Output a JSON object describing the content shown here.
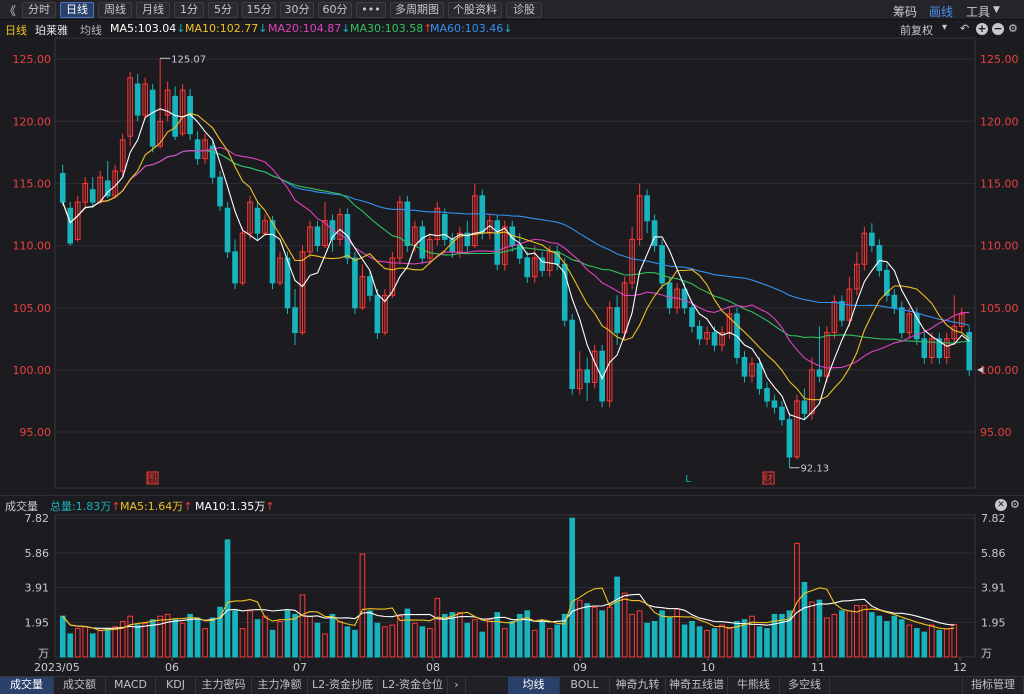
{
  "toolbar": {
    "back": "《",
    "periods": [
      "分时",
      "日线",
      "周线",
      "月线",
      "1分",
      "5分",
      "15分",
      "30分",
      "60分",
      "•••",
      "多周期图",
      "个股资料",
      "诊股"
    ],
    "active_period": "日线",
    "right": [
      "筹码",
      "画线",
      "工具"
    ],
    "tools_arrow": "▼"
  },
  "info": {
    "period": "日线",
    "stock": "珀莱雅",
    "line_type": "均线",
    "ma5": "MA5:103.04",
    "ma10": "MA10:102.77",
    "ma20": "MA20:104.87",
    "ma30": "MA30:103.58",
    "ma60": "MA60:103.46",
    "ma5_dir": "↓",
    "ma10_dir": "↓",
    "ma20_dir": "↓",
    "ma30_dir": "↑",
    "ma60_dir": "↓",
    "restore": "前复权",
    "colors": {
      "ma5": "#ffffff",
      "ma10": "#f0c020",
      "ma20": "#e040c0",
      "ma30": "#30c060",
      "ma60": "#3090f0",
      "up": "#ff3838",
      "down": "#18b4be"
    }
  },
  "price_axis": [
    "125.00",
    "120.00",
    "115.00",
    "110.00",
    "105.00",
    "100.00",
    "95.00"
  ],
  "annotations": {
    "high": "125.07",
    "low": "92.13",
    "markers": [
      "图",
      "L",
      "财"
    ]
  },
  "volume": {
    "title": "成交量",
    "total": "总量:1.83万",
    "total_dir": "↑",
    "ma5": "MA5:1.64万",
    "ma5_dir": "↑",
    "ma10": "MA10:1.35万",
    "ma10_dir": "↑",
    "axis": [
      "7.82",
      "5.86",
      "3.91",
      "1.95",
      "万"
    ]
  },
  "x_labels": [
    "2023/05",
    "06",
    "07",
    "08",
    "09",
    "10",
    "11",
    "12"
  ],
  "bottom_tabs_left": [
    "成交量",
    "成交额",
    "MACD",
    "KDJ",
    "主力密码",
    "主力净额",
    "L2-资金抄底",
    "L2-资金仓位"
  ],
  "bottom_tabs_right": [
    "均线",
    "BOLL",
    "神奇九转",
    "神奇五线谱",
    "牛熊线",
    "多空线"
  ],
  "bottom_right": "指标管理",
  "chart_data": {
    "type": "candlestick",
    "ohlc": [
      [
        115.8,
        113.5,
        116.5,
        113.2
      ],
      [
        113.0,
        110.2,
        113.5,
        110.0
      ],
      [
        110.5,
        113.5,
        114.0,
        110.3
      ],
      [
        113.5,
        115.0,
        115.5,
        113.0
      ],
      [
        114.5,
        113.5,
        115.5,
        113.0
      ],
      [
        113.5,
        115.5,
        116.0,
        113.3
      ],
      [
        115.2,
        114.0,
        116.8,
        113.8
      ],
      [
        114.0,
        116.0,
        116.5,
        113.8
      ],
      [
        116.0,
        118.5,
        119.0,
        115.5
      ],
      [
        118.8,
        123.5,
        124.0,
        118.0
      ],
      [
        123.0,
        120.5,
        123.8,
        120.0
      ],
      [
        120.5,
        123.0,
        123.5,
        120.2
      ],
      [
        122.5,
        118.0,
        123.0,
        117.5
      ],
      [
        118.0,
        120.0,
        125.07,
        117.8
      ],
      [
        120.5,
        122.5,
        123.2,
        120.0
      ],
      [
        122.0,
        118.8,
        122.8,
        118.5
      ],
      [
        119.0,
        122.5,
        123.0,
        118.8
      ],
      [
        122.0,
        119.0,
        122.6,
        118.5
      ],
      [
        118.5,
        117.0,
        119.2,
        116.5
      ],
      [
        117.0,
        118.5,
        119.0,
        116.6
      ],
      [
        118.0,
        115.5,
        118.5,
        115.0
      ],
      [
        115.5,
        113.2,
        116.0,
        112.8
      ],
      [
        113.0,
        109.5,
        113.5,
        109.0
      ],
      [
        109.5,
        107.0,
        110.5,
        106.5
      ],
      [
        107.0,
        111.0,
        111.5,
        106.8
      ],
      [
        111.0,
        113.5,
        114.0,
        110.5
      ],
      [
        113.0,
        111.0,
        113.5,
        110.5
      ],
      [
        111.0,
        112.0,
        112.5,
        110.8
      ],
      [
        112.0,
        107.0,
        112.4,
        106.5
      ],
      [
        107.0,
        109.0,
        109.5,
        106.8
      ],
      [
        109.0,
        105.0,
        109.5,
        104.5
      ],
      [
        105.0,
        103.0,
        106.5,
        102.0
      ],
      [
        103.0,
        109.5,
        110.0,
        102.8
      ],
      [
        109.5,
        111.5,
        112.0,
        109.0
      ],
      [
        111.5,
        110.0,
        112.0,
        109.5
      ],
      [
        110.0,
        112.0,
        113.5,
        109.8
      ],
      [
        112.0,
        110.5,
        112.5,
        109.5
      ],
      [
        110.5,
        112.5,
        113.0,
        110.0
      ],
      [
        112.5,
        109.0,
        113.0,
        108.5
      ],
      [
        109.0,
        105.0,
        109.5,
        104.5
      ],
      [
        105.0,
        107.5,
        108.5,
        104.8
      ],
      [
        107.5,
        106.0,
        108.0,
        105.5
      ],
      [
        106.0,
        103.0,
        106.5,
        102.5
      ],
      [
        103.0,
        106.0,
        106.5,
        102.8
      ],
      [
        106.0,
        109.0,
        109.5,
        105.8
      ],
      [
        109.0,
        113.5,
        114.0,
        108.5
      ],
      [
        113.5,
        110.0,
        114.0,
        109.5
      ],
      [
        110.0,
        111.5,
        112.0,
        109.5
      ],
      [
        111.5,
        109.0,
        112.0,
        108.5
      ],
      [
        109.0,
        110.5,
        111.0,
        108.5
      ],
      [
        110.5,
        113.0,
        113.5,
        110.0
      ],
      [
        112.5,
        110.5,
        113.0,
        110.0
      ],
      [
        110.5,
        109.5,
        111.0,
        109.0
      ],
      [
        109.5,
        111.0,
        111.5,
        109.0
      ],
      [
        111.0,
        110.0,
        112.0,
        109.5
      ],
      [
        110.0,
        114.0,
        115.0,
        109.8
      ],
      [
        114.0,
        111.0,
        114.5,
        110.5
      ],
      [
        111.0,
        112.0,
        112.5,
        110.5
      ],
      [
        112.0,
        108.5,
        112.5,
        108.0
      ],
      [
        108.5,
        111.5,
        112.0,
        108.0
      ],
      [
        111.5,
        110.0,
        112.0,
        109.5
      ],
      [
        110.0,
        109.0,
        111.0,
        108.5
      ],
      [
        109.0,
        107.5,
        109.5,
        107.0
      ],
      [
        107.5,
        109.0,
        110.0,
        107.0
      ],
      [
        109.0,
        108.0,
        109.5,
        107.5
      ],
      [
        108.0,
        109.5,
        110.0,
        107.5
      ],
      [
        109.5,
        108.5,
        110.0,
        108.0
      ],
      [
        108.5,
        104.0,
        109.0,
        103.5
      ],
      [
        104.0,
        98.5,
        104.5,
        98.0
      ],
      [
        98.5,
        100.0,
        101.5,
        98.0
      ],
      [
        100.0,
        99.0,
        101.0,
        97.5
      ],
      [
        99.0,
        101.5,
        102.0,
        98.5
      ],
      [
        101.5,
        97.5,
        102.0,
        97.0
      ],
      [
        97.5,
        105.0,
        105.5,
        97.0
      ],
      [
        105.0,
        103.0,
        106.0,
        102.0
      ],
      [
        103.0,
        107.0,
        107.5,
        102.5
      ],
      [
        107.0,
        110.5,
        111.5,
        106.5
      ],
      [
        110.5,
        114.0,
        115.0,
        110.0
      ],
      [
        114.0,
        112.0,
        114.5,
        111.0
      ],
      [
        112.0,
        110.0,
        112.5,
        109.5
      ],
      [
        110.0,
        107.0,
        110.5,
        106.5
      ],
      [
        107.0,
        105.0,
        107.5,
        104.5
      ],
      [
        105.0,
        106.5,
        107.0,
        104.5
      ],
      [
        106.5,
        105.0,
        107.0,
        104.5
      ],
      [
        105.0,
        103.5,
        105.5,
        103.0
      ],
      [
        103.5,
        102.5,
        104.0,
        102.0
      ],
      [
        102.5,
        103.0,
        103.5,
        102.0
      ],
      [
        103.0,
        102.0,
        103.5,
        101.5
      ],
      [
        102.0,
        103.0,
        103.5,
        101.5
      ],
      [
        103.0,
        104.5,
        105.0,
        102.5
      ],
      [
        104.5,
        101.0,
        105.0,
        100.5
      ],
      [
        101.0,
        99.5,
        101.5,
        99.0
      ],
      [
        99.5,
        100.5,
        101.0,
        99.0
      ],
      [
        100.5,
        98.5,
        101.0,
        98.0
      ],
      [
        98.5,
        97.5,
        99.0,
        97.0
      ],
      [
        97.5,
        97.0,
        98.0,
        96.5
      ],
      [
        97.0,
        96.0,
        97.5,
        95.5
      ],
      [
        96.0,
        93.0,
        96.5,
        92.13
      ],
      [
        93.0,
        97.5,
        98.0,
        92.8
      ],
      [
        97.5,
        96.5,
        98.5,
        96.0
      ],
      [
        96.5,
        100.0,
        101.0,
        96.0
      ],
      [
        100.0,
        99.5,
        103.5,
        99.0
      ],
      [
        99.5,
        103.0,
        103.5,
        99.0
      ],
      [
        103.0,
        105.5,
        106.0,
        102.5
      ],
      [
        105.5,
        104.0,
        106.0,
        103.5
      ],
      [
        104.0,
        106.5,
        107.5,
        103.5
      ],
      [
        106.5,
        108.5,
        109.5,
        106.0
      ],
      [
        108.5,
        111.0,
        111.5,
        108.0
      ],
      [
        111.0,
        110.0,
        111.8,
        109.5
      ],
      [
        110.0,
        108.0,
        110.5,
        107.5
      ],
      [
        108.0,
        106.0,
        108.5,
        105.5
      ],
      [
        106.0,
        105.0,
        106.5,
        104.5
      ],
      [
        105.0,
        103.0,
        105.5,
        102.5
      ],
      [
        103.0,
        104.5,
        105.0,
        102.5
      ],
      [
        104.5,
        102.5,
        105.0,
        102.0
      ],
      [
        102.5,
        101.0,
        103.0,
        100.5
      ],
      [
        101.0,
        102.5,
        103.0,
        100.5
      ],
      [
        102.5,
        101.0,
        103.0,
        100.5
      ],
      [
        101.0,
        102.5,
        103.0,
        100.5
      ],
      [
        102.5,
        103.5,
        106.0,
        102.0
      ],
      [
        103.5,
        104.5,
        105.0,
        103.0
      ],
      [
        103.0,
        100.0,
        103.5,
        99.5
      ]
    ],
    "volume": [
      2.3,
      1.3,
      1.6,
      1.7,
      1.3,
      1.5,
      1.6,
      1.7,
      2.0,
      2.3,
      1.8,
      1.9,
      2.1,
      2.3,
      2.4,
      2.1,
      1.9,
      2.4,
      2.2,
      1.6,
      2.2,
      2.8,
      6.6,
      2.6,
      1.6,
      2.6,
      2.1,
      2.3,
      1.5,
      2.0,
      2.6,
      2.4,
      3.5,
      2.3,
      1.9,
      1.3,
      2.4,
      2.0,
      1.7,
      1.5,
      5.8,
      2.6,
      1.9,
      1.7,
      1.8,
      2.3,
      2.7,
      1.9,
      1.7,
      1.6,
      3.3,
      2.4,
      2.5,
      2.5,
      1.9,
      2.1,
      1.4,
      2.1,
      2.5,
      1.6,
      2.0,
      2.4,
      2.6,
      1.5,
      2.0,
      1.6,
      1.8,
      2.4,
      7.82,
      3.2,
      3.0,
      2.8,
      2.6,
      2.8,
      4.5,
      3.6,
      2.4,
      2.6,
      1.9,
      2.0,
      2.6,
      2.2,
      2.7,
      1.8,
      2.0,
      1.7,
      1.5,
      1.6,
      1.8,
      1.6,
      2.0,
      2.1,
      2.3,
      1.7,
      1.6,
      2.4,
      2.4,
      2.6,
      6.4,
      4.2,
      3.1,
      3.2,
      2.2,
      2.4,
      2.6,
      2.6,
      2.9,
      2.9,
      2.5,
      2.3,
      2.0,
      2.3,
      2.1,
      1.8,
      1.6,
      1.4,
      1.8,
      1.5,
      1.6,
      1.83
    ],
    "ylim": [
      90.5,
      126.7
    ],
    "vol_ylim": [
      0,
      8.0
    ]
  }
}
